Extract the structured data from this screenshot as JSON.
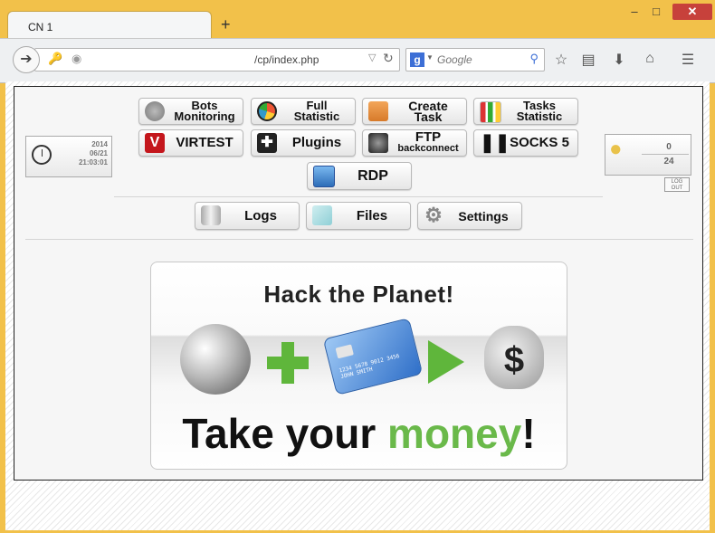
{
  "browser": {
    "tab_title": "CN 1",
    "new_tab": "+",
    "url": "/cp/index.php",
    "search_placeholder": "Google",
    "search_engine_letter": "g"
  },
  "clock": {
    "year": "2014",
    "date": "06/21",
    "time": "21:03:01"
  },
  "stats": {
    "top": "0",
    "bottom": "24",
    "logout_line1": "LOG",
    "logout_line2": "OUT"
  },
  "menu": {
    "bots_monitoring": [
      "Bots",
      "Monitoring"
    ],
    "full_statistic": [
      "Full",
      "Statistic"
    ],
    "create_task": "Create Task",
    "tasks_statistic": [
      "Tasks",
      "Statistic"
    ],
    "virtest": "VIRTEST",
    "plugins": "Plugins",
    "ftp": [
      "FTP",
      "backconnect"
    ],
    "socks5": "SOCKS 5",
    "rdp": "RDP",
    "logs": "Logs",
    "files": "Files",
    "settings": "Settings"
  },
  "banner": {
    "title": "Hack the Planet!",
    "slogan_part1": "Take your ",
    "slogan_green": "money",
    "slogan_end": "!",
    "card_number": "1234 5678 9012 3456",
    "card_name": "JOHN SMITH",
    "bag_symbol": "$"
  },
  "colors": {
    "accent_green": "#6ab94a",
    "frame": "#f2c14a"
  }
}
